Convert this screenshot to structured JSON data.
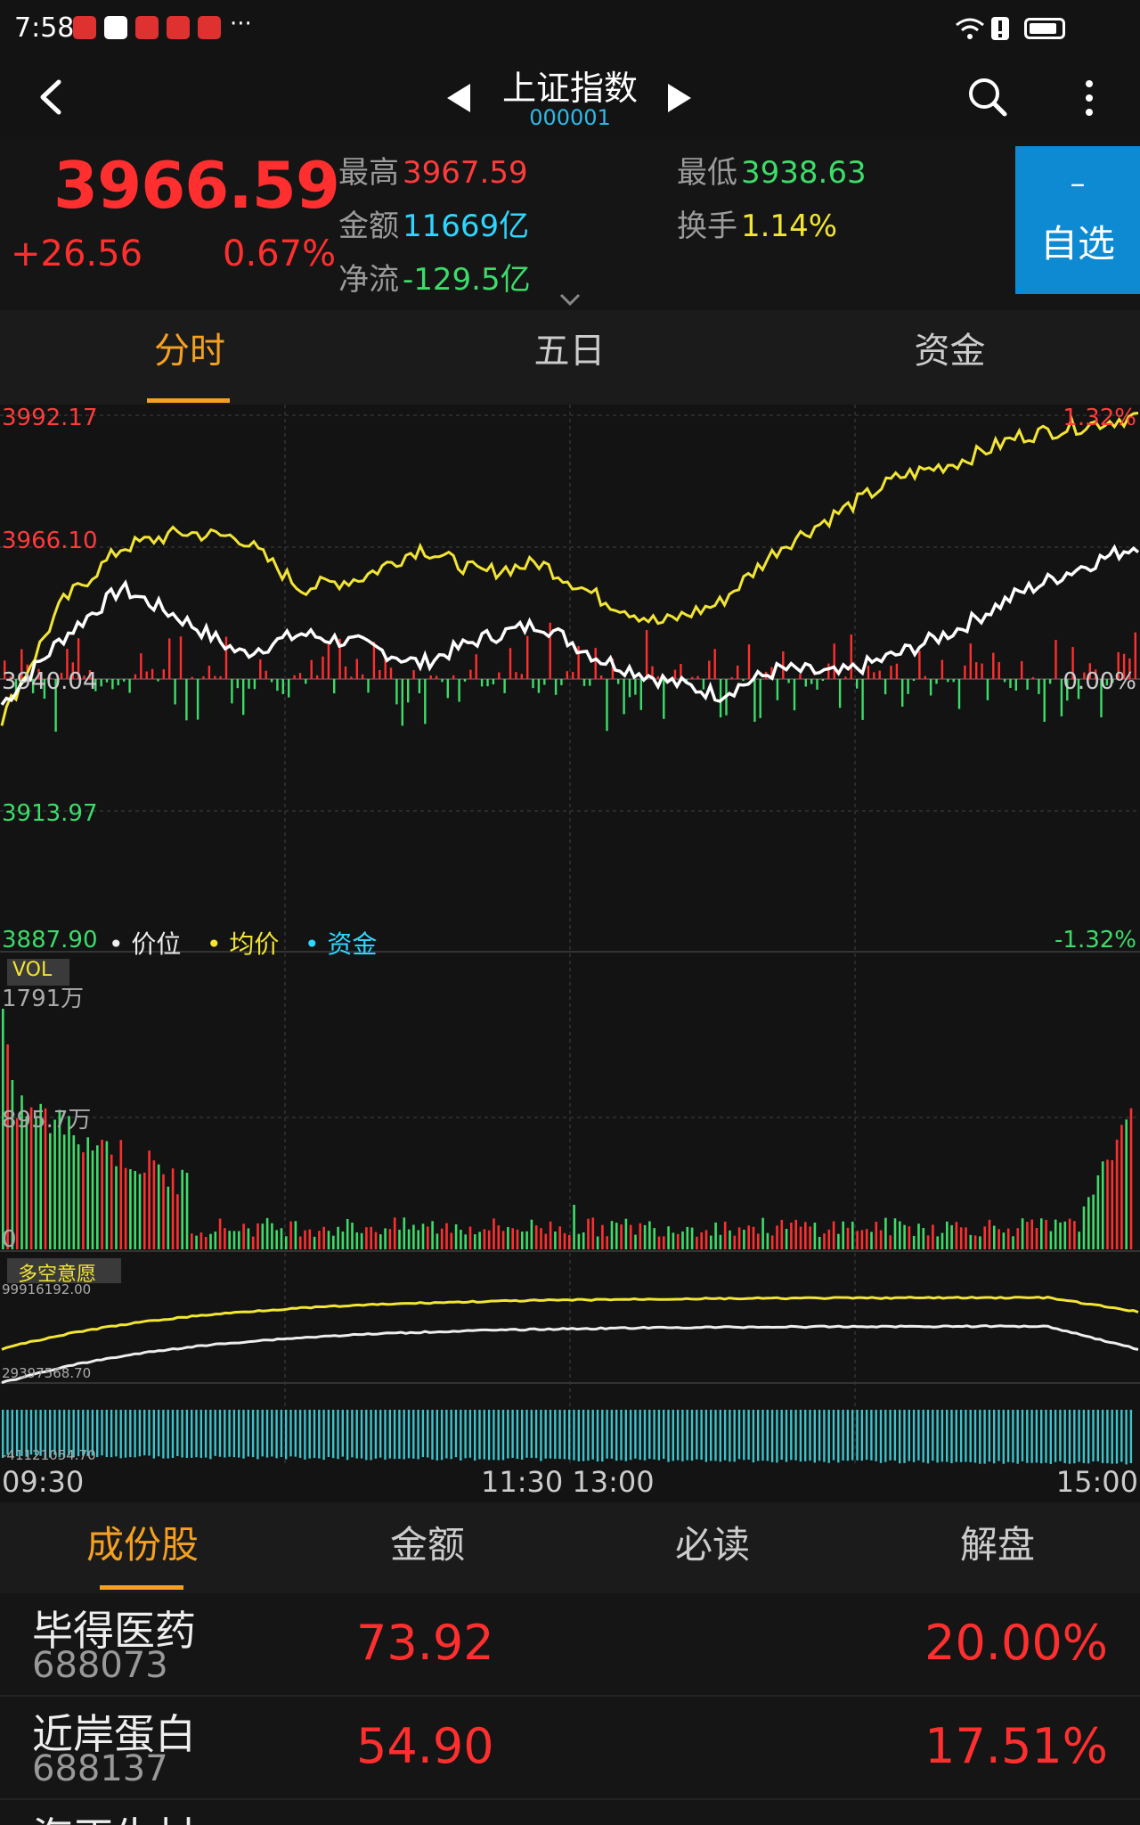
{
  "status": {
    "time": "7:58",
    "more": "···"
  },
  "header": {
    "title": "上证指数",
    "code": "000001"
  },
  "quote": {
    "price": "3966.59",
    "change": "+26.56",
    "change_pct": "0.67%",
    "high_label": "最高",
    "high": "3967.59",
    "low_label": "最低",
    "low": "3938.63",
    "amount_label": "金额",
    "amount": "11669亿",
    "turnover_label": "换手",
    "turnover": "1.14%",
    "netflow_label": "净流",
    "netflow": "-129.5亿",
    "watch_dash": "–",
    "watch_label": "自选"
  },
  "tabs": [
    "分时",
    "五日",
    "资金"
  ],
  "chart_labels": {
    "y_top": "3992.17",
    "pct_top": "1.32%",
    "y_mid_up": "3966.10",
    "y_base": "3940.04",
    "pct_base": "0.00%",
    "y_mid_down": "3913.97",
    "y_bottom": "3887.90",
    "pct_bottom": "-1.32%",
    "legend_price": "价位",
    "legend_avg": "均价",
    "legend_fund": "资金",
    "vol_label": "VOL",
    "vol_top": "1791万",
    "vol_mid": "895.7万",
    "vol_zero": "0",
    "ind_label": "多空意愿",
    "ind_top": "99916192.00",
    "ind_mid": "29397568.70",
    "ind_bottom": "-41121054.70",
    "time_start": "09:30",
    "time_mid": "11:30 13:00",
    "time_end": "15:00"
  },
  "colors": {
    "up": "#ff2f2f",
    "down": "#3ddc6a",
    "accent": "#f5a020",
    "avg": "#f2e535",
    "fund": "#2ed6ff"
  },
  "bottom_tabs": [
    "成份股",
    "金额",
    "必读",
    "解盘"
  ],
  "stocks": [
    {
      "name": "毕得医药",
      "code": "688073",
      "price": "73.92",
      "pct": "20.00%"
    },
    {
      "name": "近岸蛋白",
      "code": "688137",
      "price": "54.90",
      "pct": "17.51%"
    },
    {
      "name": "海正生材",
      "code": "",
      "price": "",
      "pct": ""
    }
  ],
  "chart_data": {
    "type": "line",
    "x": [
      "09:30",
      "11:30 13:00",
      "15:00"
    ],
    "ylim": [
      3887.9,
      3992.17
    ],
    "base": 3940.04,
    "series": [
      {
        "name": "价位",
        "values": [
          3935,
          3948,
          3958,
          3952,
          3945,
          3949,
          3947,
          3943,
          3948,
          3951,
          3944,
          3940,
          3937,
          3942,
          3941,
          3945,
          3950,
          3957,
          3962,
          3966.59
        ]
      },
      {
        "name": "均价",
        "values": [
          3932,
          3955,
          3966,
          3969,
          3968,
          3958,
          3960,
          3966,
          3961,
          3963,
          3956,
          3951,
          3955,
          3966,
          3973,
          3980,
          3983,
          3988,
          3990,
          3992
        ]
      }
    ]
  }
}
